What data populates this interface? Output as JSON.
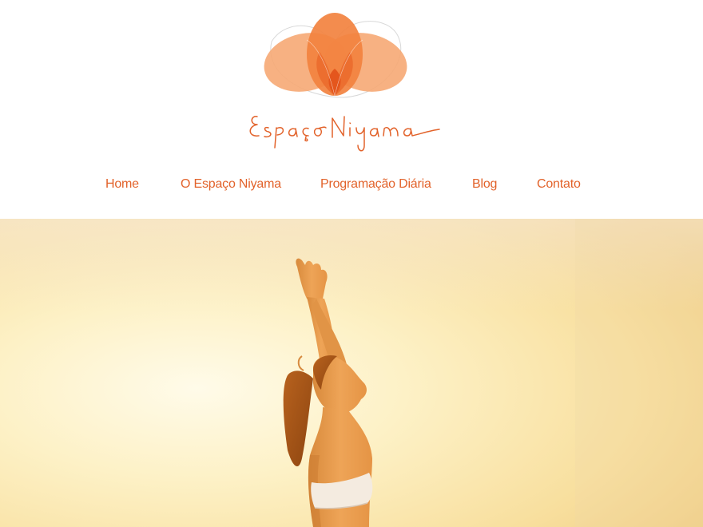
{
  "brand": {
    "name": "Espaço Niyama",
    "logo_icon": "lotus-icon",
    "accent_color": "#e2622a",
    "petal_color": "#f29a61"
  },
  "nav": {
    "items": [
      {
        "label": "Home"
      },
      {
        "label": "O Espaço Niyama"
      },
      {
        "label": "Programação Diária"
      },
      {
        "label": "Blog"
      },
      {
        "label": "Contato"
      }
    ]
  },
  "hero": {
    "image": "woman-yoga-arms-raised-sunlight-photo"
  }
}
